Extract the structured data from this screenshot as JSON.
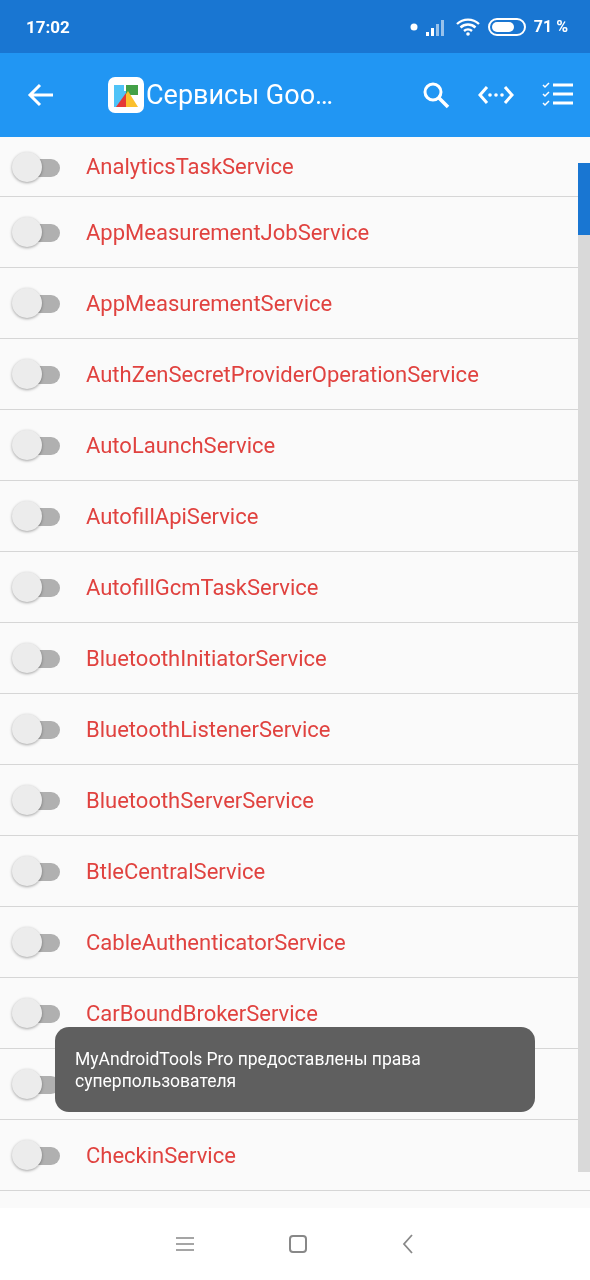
{
  "status_bar": {
    "time": "17:02",
    "battery": "71 %"
  },
  "toolbar": {
    "title": "Сервисы Goo…"
  },
  "services": [
    {
      "name": "AnalyticsTaskService",
      "on": false
    },
    {
      "name": "AppMeasurementJobService",
      "on": false
    },
    {
      "name": "AppMeasurementService",
      "on": false
    },
    {
      "name": "AuthZenSecretProviderOperationService",
      "on": false
    },
    {
      "name": "AutoLaunchService",
      "on": false
    },
    {
      "name": "AutofillApiService",
      "on": false
    },
    {
      "name": "AutofillGcmTaskService",
      "on": false
    },
    {
      "name": "BluetoothInitiatorService",
      "on": false
    },
    {
      "name": "BluetoothListenerService",
      "on": false
    },
    {
      "name": "BluetoothServerService",
      "on": false
    },
    {
      "name": "BtleCentralService",
      "on": false
    },
    {
      "name": "CableAuthenticatorService",
      "on": false
    },
    {
      "name": "CarBoundBrokerService",
      "on": false
    },
    {
      "on": false
    },
    {
      "name": "CheckinService",
      "on": false
    }
  ],
  "toast": {
    "text": "MyAndroidTools Pro предоставлены права суперпользователя"
  }
}
